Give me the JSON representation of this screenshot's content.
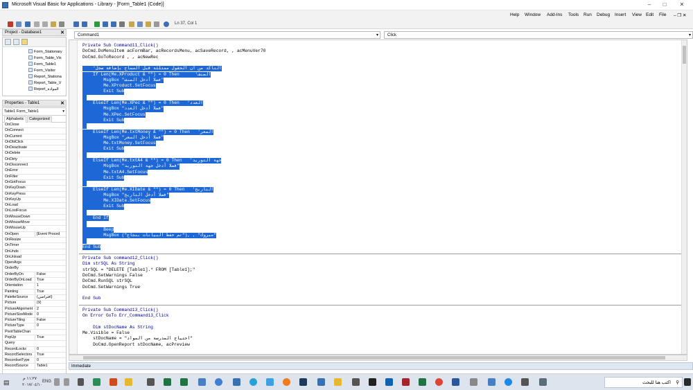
{
  "window": {
    "title": "Microsoft Visual Basic for Applications - Library - [Form_Table1 (Code)]"
  },
  "menu": [
    "Help",
    "Window",
    "Add-Ins",
    "Tools",
    "Run",
    "Debug",
    "Insert",
    "View",
    "Edit",
    "File"
  ],
  "toolbar": {
    "status": "Ln 37, Col 1"
  },
  "project": {
    "title": "Project - Database1",
    "items": [
      "Form_Stationary",
      "Form_Table_Vis",
      "Form_Table1",
      "Form_Visitor",
      "Report_Stationa",
      "Report_Table_V",
      "Report_الموادة"
    ]
  },
  "properties": {
    "title": "Properties - Table1",
    "object": "Table1 Form_Table1",
    "tabs": [
      "Alphabetic",
      "Categorized"
    ],
    "rows": [
      [
        "OnClose",
        ""
      ],
      [
        "OnConnect",
        ""
      ],
      [
        "OnCurrent",
        ""
      ],
      [
        "OnDblClick",
        ""
      ],
      [
        "OnDeactivate",
        ""
      ],
      [
        "OnDelete",
        ""
      ],
      [
        "OnDirty",
        ""
      ],
      [
        "OnDisconnect",
        ""
      ],
      [
        "OnError",
        ""
      ],
      [
        "OnFilter",
        ""
      ],
      [
        "OnGotFocus",
        ""
      ],
      [
        "OnKeyDown",
        ""
      ],
      [
        "OnKeyPress",
        ""
      ],
      [
        "OnKeyUp",
        ""
      ],
      [
        "OnLoad",
        ""
      ],
      [
        "OnLostFocus",
        ""
      ],
      [
        "OnMouseDown",
        ""
      ],
      [
        "OnMouseMove",
        ""
      ],
      [
        "OnMouseUp",
        ""
      ],
      [
        "OnOpen",
        "[Event Proced"
      ],
      [
        "OnResize",
        ""
      ],
      [
        "OnTimer",
        ""
      ],
      [
        "OnUndo",
        ""
      ],
      [
        "OnUnload",
        ""
      ],
      [
        "OpenArgs",
        ""
      ],
      [
        "OrderBy",
        ""
      ],
      [
        "OrderByOn",
        "False"
      ],
      [
        "OrderByOnLoad",
        "True"
      ],
      [
        "Orientation",
        "1"
      ],
      [
        "Painting",
        "True"
      ],
      [
        "PaletteSource",
        "(افتراضي)"
      ],
      [
        "Picture",
        "(لا)"
      ],
      [
        "PictureAlignment",
        "2"
      ],
      [
        "PictureSizeMode",
        "0"
      ],
      [
        "PictureTiling",
        "False"
      ],
      [
        "PictureType",
        "0"
      ],
      [
        "PivotTableChan",
        ""
      ],
      [
        "PopUp",
        "True"
      ],
      [
        "Query",
        ""
      ],
      [
        "RecordLocks",
        "0"
      ],
      [
        "RecordSelectors",
        "True"
      ],
      [
        "RecordsetType",
        "0"
      ],
      [
        "RecordSource",
        "Table1"
      ]
    ]
  },
  "editor": {
    "object_combo": "Command1",
    "procedure_combo": "Click",
    "lines": [
      "Private Sub Command11_Click()",
      "DoCmd.DoMenuItem acFormBar, acRecordsMenu, acSaveRecord, , acMenuVer70",
      "DoCmd.GoToRecord , , acNewRec",
      "",
      "    'التأكد من أن الحقول ممتلئة قبل السماح بإضافة سجل",
      "    If Len(Me.XProduct & \"\") = 0 Then      'الصنف",
      "        MsgBox \"فضلا أدخل الصنف\"",
      "        Me.XProduct.SetFocus",
      "        Exit Sub",
      "",
      "    ElseIf Len(Me.XPec & \"\") = 0 Then   'العدد",
      "        MsgBox \"فضلا أدخل العدد\"",
      "        Me.XPec.SetFocus",
      "        Exit Sub",
      "",
      "    ElseIf Len(Me.txtMoney & \"\") = 0 Then   'السعر",
      "        MsgBox \"فضلا أدخل السعر\"",
      "        Me.txtMoney.SetFocus",
      "        Exit Sub",
      "",
      "    ElseIf Len(Me.txtA4 & \"\") = 0 Then   'جهة التوريد",
      "        MsgBox \"فضلا أدخل جهة التوريد\"",
      "        Me.txtA4.SetFocus",
      "        Exit Sub",
      "",
      "    ElseIf Len(Me.XIDate & \"\") = 0 Then   'التاريخ",
      "        MsgBox \"فضلا أدخل التاريخ\"",
      "        Me.XIDate.SetFocus",
      "        Exit Sub",
      "",
      "    End If",
      "",
      "        Beep",
      "        MsgBox (\"تم حفظ البيانات بنجاح\"), , \"مبروك\"",
      "",
      "End Sub",
      "",
      "Private Sub command12_Click()",
      "Dim strSQL As String",
      "strSQL = \"DELETE [Table1].* FROM [Table1];\"",
      "DoCmd.SetWarnings False",
      "DoCmd.RunSQL strSQL",
      "DoCmd.SetWarnings True",
      "",
      "End Sub",
      "",
      "Private Sub Command13_Click()",
      "On Error GoTo Err_Command13_Click",
      "",
      "    Dim stDocName As String",
      "Me.Visible = False",
      "    stDocName = \"احتياج المدرسة من المواد\"",
      "    DoCmd.OpenReport stDocName, acPreview"
    ]
  },
  "immediate": {
    "title": "Immediate"
  },
  "taskbar": {
    "search_placeholder": "اكتب هنا للبحث",
    "lang": "ENG",
    "time": "١١:٢٧ م",
    "date": "٢٠١٧/٠٤/١٠"
  },
  "colors": {
    "selection": "#1e67d6",
    "keyword": "#00008b",
    "taskbar": "#dde4ee"
  }
}
